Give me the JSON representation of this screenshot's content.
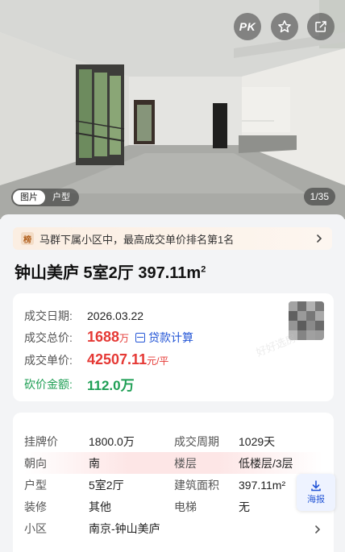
{
  "hero": {
    "pk_label": "PK",
    "tabs": [
      "图片",
      "户型"
    ],
    "active_tab": "图片",
    "counter": "1/35",
    "watermark": "好好选房"
  },
  "rank_banner": {
    "tag": "榜",
    "text": "马群下属小区中，最高成交单价排名第1名"
  },
  "listing": {
    "title_main": "钟山美庐 5室2厅 397.11m",
    "title_sup": "2"
  },
  "deal": {
    "date_label": "成交日期:",
    "date_value": "2026.03.22",
    "total_label": "成交总价:",
    "total_number": "1688",
    "total_unit": "万",
    "loan_calc_label": "贷款计算",
    "unit_label": "成交单价:",
    "unit_number": "42507.11",
    "unit_suffix": "元/平",
    "bargain_label": "砍价金额:",
    "bargain_value": "112.0万"
  },
  "details": {
    "rows": [
      {
        "l": "挂牌价",
        "v": "1800.0万",
        "l2": "成交周期",
        "v2": "1029天"
      },
      {
        "l": "朝向",
        "v": "南",
        "l2": "楼层",
        "v2": "低楼层/3层"
      },
      {
        "l": "户型",
        "v": "5室2厅",
        "l2": "建筑面积",
        "v2": "397.11m²"
      },
      {
        "l": "装修",
        "v": "其他",
        "l2": "电梯",
        "v2": "无"
      },
      {
        "l": "小区",
        "v": "南京-钟山美庐",
        "l2": "",
        "v2": ""
      }
    ]
  },
  "poster": {
    "label": "海报"
  },
  "colors": {
    "price_red": "#e53935",
    "bargain_green": "#1f9f55",
    "link_blue": "#2456d6"
  }
}
